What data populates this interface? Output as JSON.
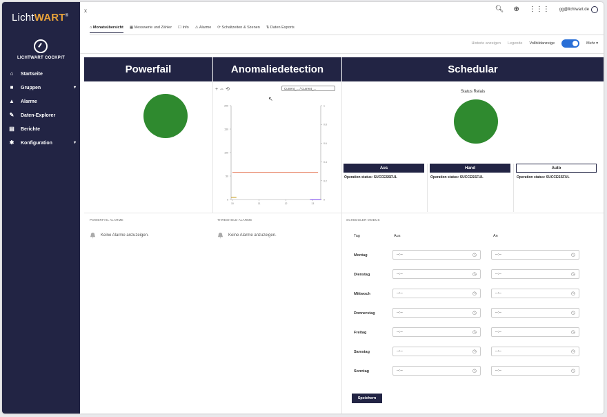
{
  "app": {
    "logo_text": "LichtWART",
    "logo_sup": "®",
    "cockpit_label": "LICHTWART COCKPIT"
  },
  "sidebar": {
    "items": [
      {
        "label": "Startseite",
        "icon": "home-icon",
        "expandable": false
      },
      {
        "label": "Gruppen",
        "icon": "folder-icon",
        "expandable": true
      },
      {
        "label": "Alarme",
        "icon": "bell-icon",
        "expandable": false
      },
      {
        "label": "Daten-Explorer",
        "icon": "explorer-icon",
        "expandable": false
      },
      {
        "label": "Berichte",
        "icon": "report-icon",
        "expandable": false
      },
      {
        "label": "Konfiguration",
        "icon": "config-icon",
        "expandable": true
      }
    ]
  },
  "header": {
    "close_label": "x",
    "user_email": "gg@lichtwart.de",
    "tabs": [
      {
        "label": "Monatsübersicht",
        "active": true
      },
      {
        "label": "Messwerte und Zähler",
        "active": false
      },
      {
        "label": "Info",
        "active": false
      },
      {
        "label": "Alarme",
        "active": false
      },
      {
        "label": "Schaltzeiten & Szenen",
        "active": false
      },
      {
        "label": "Daten Exports",
        "active": false
      }
    ]
  },
  "toolbar": {
    "item1": "Historie anzeigen",
    "item2": "Legende",
    "item3": "Vollbildanzeige",
    "more": "Mehr"
  },
  "panels": {
    "powerfail_title": "Powerfail",
    "anomalie_title": "Anomaliedetection",
    "schedular_title": "Schedular",
    "chart_select": "Current_... / Current_...",
    "status_title": "Status Relais"
  },
  "colors": {
    "sidebar_bg": "#222444",
    "status_green": "#2f8a2f",
    "accent_blue": "#2a6fd6",
    "line_orange": "#e8896c",
    "line_purple": "#8a5cf0",
    "line_olive": "#c9a227"
  },
  "chart_data": {
    "type": "line",
    "x_ticks": [
      "10",
      "11",
      "12",
      "13"
    ],
    "y_left_ticks": [
      "200",
      "150",
      "100",
      "50",
      "0"
    ],
    "y_right_ticks": [
      "1",
      "0.8",
      "0.6",
      "0.4",
      "0.2",
      "0"
    ],
    "series": [
      {
        "color": "#e8896c",
        "x": [
          10,
          13.2
        ],
        "y": [
          58,
          58
        ]
      },
      {
        "color": "#c9a227",
        "x": [
          9.95,
          10.15
        ],
        "y": [
          5,
          5
        ]
      },
      {
        "color": "#8a5cf0",
        "x": [
          12.9,
          13.3
        ],
        "y": [
          0,
          0
        ]
      }
    ],
    "xlabel": "",
    "ylabel": "",
    "ylim": [
      0,
      200
    ]
  },
  "schedular": {
    "modes": [
      {
        "label": "Aus",
        "style": "dark"
      },
      {
        "label": "Hand",
        "style": "dark"
      },
      {
        "label": "Auto",
        "style": "light"
      }
    ],
    "op_status_1": "Operation status: SUCCESSFUL",
    "op_status_2": "Operation status: SUCCESSFUL",
    "op_status_3": "Operation status: SUCCESSFUL"
  },
  "alarms": {
    "powerfail_label": "POWERFAIL ALARME",
    "threshold_label": "THRESHOLD ALARME",
    "none_text_1": "Keine Alarme anzuzeigen.",
    "none_text_2": "Keine Alarme anzuzeigen."
  },
  "schedule": {
    "section_label": "SCHEDULER MODUS",
    "col_day": "Tag",
    "col_on": "Aus",
    "col_off": "An",
    "rows": [
      {
        "day": "Montag",
        "aus": "--:--",
        "an": "--:--"
      },
      {
        "day": "Dienstag",
        "aus": "--:--",
        "an": "--:--"
      },
      {
        "day": "Mittwoch",
        "aus": "--:--",
        "an": "--:--"
      },
      {
        "day": "Donnerstag",
        "aus": "--:--",
        "an": "--:--"
      },
      {
        "day": "Freitag",
        "aus": "--:--",
        "an": "--:--"
      },
      {
        "day": "Samstag",
        "aus": "--:--",
        "an": "--:--"
      },
      {
        "day": "Sonntag",
        "aus": "--:--",
        "an": "--:--"
      }
    ],
    "save_label": "Speichern"
  }
}
